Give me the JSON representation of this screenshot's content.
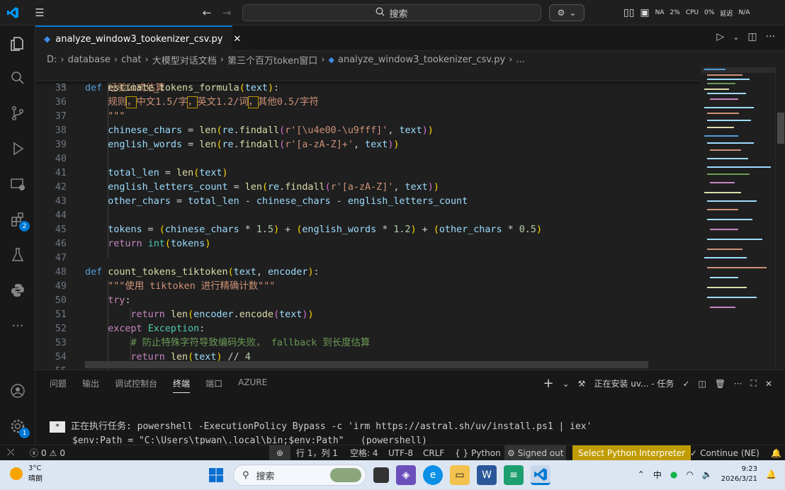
{
  "titlebar": {
    "search_label": "搜索",
    "right_status": [
      "NA",
      "2%",
      "CPU",
      "0%",
      "延迟",
      "N/A"
    ]
  },
  "tab": {
    "filename": "analyze_window3_tookenizer_csv.py",
    "close": "✕"
  },
  "breadcrumb": [
    "D:",
    "database",
    "chat",
    "大模型对话文档",
    "第三个百万token窗口",
    "analyze_window3_tookenizer_csv.py",
    "..."
  ],
  "sticky_line": {
    "ln": "33"
  },
  "lines": [
    {
      "ln": "35"
    },
    {
      "ln": "36"
    },
    {
      "ln": "37"
    },
    {
      "ln": "38"
    },
    {
      "ln": "39"
    },
    {
      "ln": "40"
    },
    {
      "ln": "41"
    },
    {
      "ln": "42"
    },
    {
      "ln": "43"
    },
    {
      "ln": "44"
    },
    {
      "ln": "45"
    },
    {
      "ln": "46"
    },
    {
      "ln": "47"
    },
    {
      "ln": "48"
    },
    {
      "ln": "49"
    },
    {
      "ln": "50"
    },
    {
      "ln": "51"
    },
    {
      "ln": "52"
    },
    {
      "ln": "53"
    },
    {
      "ln": "54"
    },
    {
      "ln": "55"
    }
  ],
  "panel": {
    "tabs": [
      "问题",
      "输出",
      "调试控制台",
      "终端",
      "端口",
      "AZURE"
    ],
    "task_label": "正在安装 uv... - 任务",
    "terminal_line1": "正在执行任务: powershell -ExecutionPolicy Bypass -c 'irm https://astral.sh/uv/install.ps1 | iex'",
    "terminal_line2": "$env:Path = \"C:\\Users\\tpwan\\.local\\bin;$env:Path\"   (powershell)",
    "terminal_marker": "*"
  },
  "statusbar": {
    "errors": "0",
    "warnings": "0",
    "position": "行 1，列 1",
    "spaces": "空格: 4",
    "encoding": "UTF-8",
    "eol": "CRLF",
    "language": "Python",
    "signed": "Signed out",
    "interpreter": "Select Python Interpreter",
    "continue": "Continue (NE)"
  },
  "taskbar": {
    "temp": "3°C",
    "weather": "晴朗",
    "search": "搜索",
    "ime": "中",
    "time": "9:23",
    "date": "2026/3/21"
  },
  "badges": {
    "extensions": "2",
    "settings": "1"
  }
}
